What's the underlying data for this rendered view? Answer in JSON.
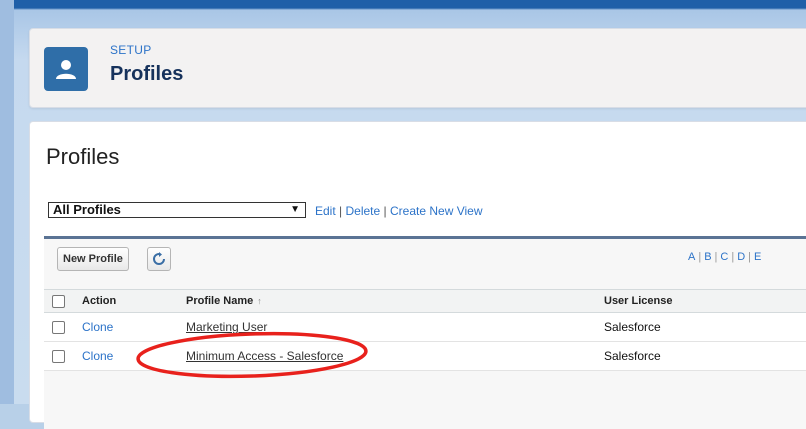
{
  "header": {
    "section": "SETUP",
    "title": "Profiles",
    "icon": "user-icon"
  },
  "main": {
    "heading": "Profiles",
    "view_select": {
      "selected": "All Profiles"
    },
    "view_links": {
      "edit": "Edit",
      "delete": "Delete",
      "create": "Create New View"
    }
  },
  "toolbar": {
    "new_profile_label": "New Profile",
    "refresh_icon": "refresh-icon",
    "alpha": [
      "A",
      "B",
      "C",
      "D",
      "E"
    ]
  },
  "table": {
    "columns": {
      "action": "Action",
      "profile_name": "Profile Name",
      "user_license": "User License"
    },
    "rows": [
      {
        "action": "Clone",
        "profile_name": "Marketing User",
        "user_license": "Salesforce"
      },
      {
        "action": "Clone",
        "profile_name": "Minimum Access - Salesforce",
        "user_license": "Salesforce"
      }
    ]
  },
  "colors": {
    "accent": "#2c73c8",
    "icon_bg": "#2f6ea8",
    "highlight": "#e8211c"
  }
}
